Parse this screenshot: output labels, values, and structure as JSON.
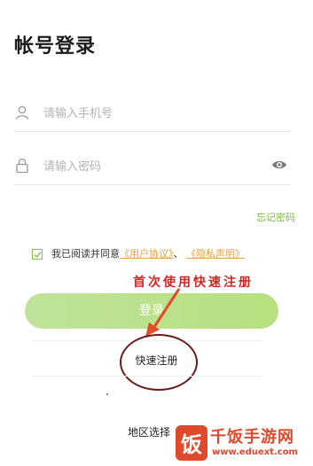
{
  "page": {
    "title": "帐号登录"
  },
  "phone": {
    "placeholder": "请输入手机号"
  },
  "password": {
    "placeholder": "请输入密码"
  },
  "forgot": {
    "label": "忘记密码"
  },
  "agreement": {
    "prefix": "我已阅读并同意",
    "user_agreement": "《用户协议》",
    "separator": "、",
    "privacy": "《隐私声明》",
    "checked": true
  },
  "annotation": {
    "text": "首次使用快速注册"
  },
  "login": {
    "label": "登录"
  },
  "quick_register": {
    "label": "快速注册"
  },
  "region": {
    "label": "地区选择"
  },
  "watermark": {
    "name": "千饭手游网",
    "url": "www.eduext.com",
    "glyph": "饭"
  },
  "colors": {
    "accent": "#7cbb3a",
    "link": "#e8a03f",
    "annotation": "#d32424",
    "button": "#bfe29a"
  }
}
